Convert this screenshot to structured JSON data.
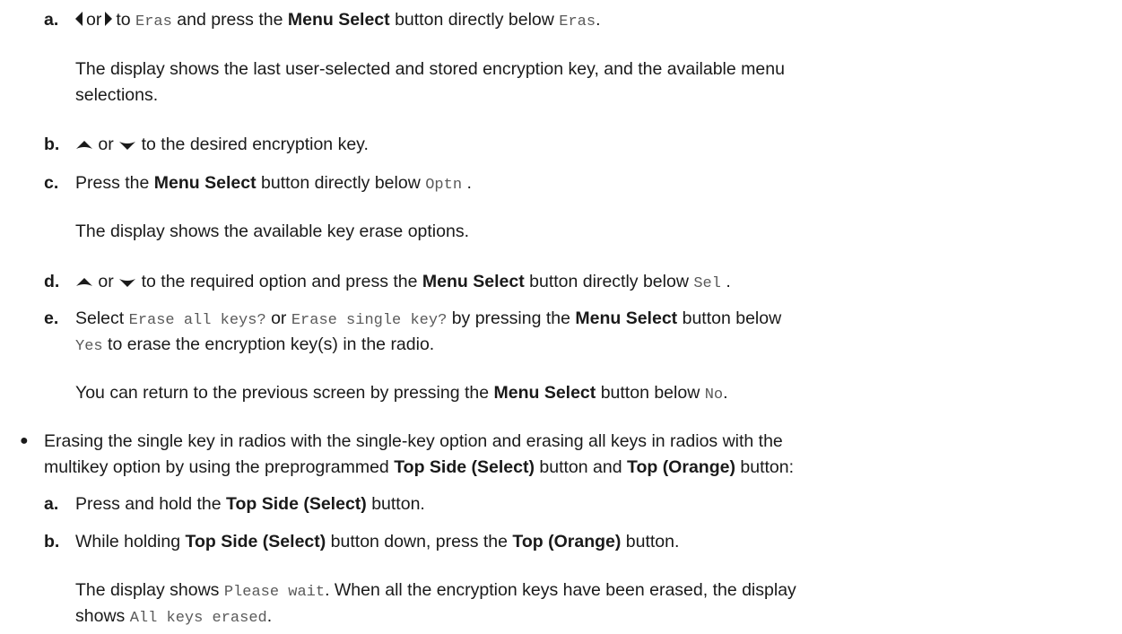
{
  "step_a": {
    "marker": "a.",
    "or": "or",
    "to": "to",
    "eras1": "Eras",
    "and_press": "and press the",
    "menu_select": "Menu Select",
    "directly_below": "button directly below",
    "eras2": "Eras",
    "period": ".",
    "desc_line1": "The display shows the last user-selected and stored encryption key, and the available menu",
    "desc_line2": "selections."
  },
  "step_b": {
    "marker": "b.",
    "or": "or",
    "rest": "to the desired encryption key."
  },
  "step_c": {
    "marker": "c.",
    "press_the": "Press the",
    "menu_select": "Menu Select",
    "directly_below": "button directly below",
    "optn": "Optn",
    "period": ".",
    "desc": "The display shows the available key erase options."
  },
  "step_d": {
    "marker": "d.",
    "or": "or",
    "to_required": "to the required option and press the",
    "menu_select": "Menu Select",
    "directly_below": "button directly below",
    "sel": "Sel",
    "period": "."
  },
  "step_e": {
    "marker": "e.",
    "select": "Select",
    "erase_all": "Erase all keys?",
    "or": "or",
    "erase_single": "Erase single key?",
    "by_pressing": "by pressing the",
    "menu_select": "Menu Select",
    "button_below": "button below",
    "yes": "Yes",
    "to_erase": "to erase the encryption key(s) in the radio.",
    "return_text": "You can return to the previous screen by pressing the",
    "menu_select2": "Menu Select",
    "button_below2": "button below",
    "no": "No",
    "period": "."
  },
  "bullet2": {
    "symbol": "●",
    "line1": "Erasing the single key in radios with the single-key option and erasing all keys in radios with the",
    "line2_start": "multikey option by using the preprogrammed",
    "top_side_select": "Top Side (Select)",
    "button_and": "button and",
    "top_orange": "Top (Orange)",
    "button_colon": "button:"
  },
  "step2_a": {
    "marker": "a.",
    "press_hold": "Press and hold the",
    "top_side_select": "Top Side (Select)",
    "button": "button."
  },
  "step2_b": {
    "marker": "b.",
    "while_holding": "While holding",
    "top_side_select": "Top Side (Select)",
    "button_down": "button down, press the",
    "top_orange": "Top (Orange)",
    "button": "button.",
    "display_shows": "The display shows",
    "please_wait": "Please wait",
    "when_all": ". When all the encryption keys have been erased, the display",
    "shows": "shows",
    "all_erased": "All keys erased",
    "period": "."
  }
}
